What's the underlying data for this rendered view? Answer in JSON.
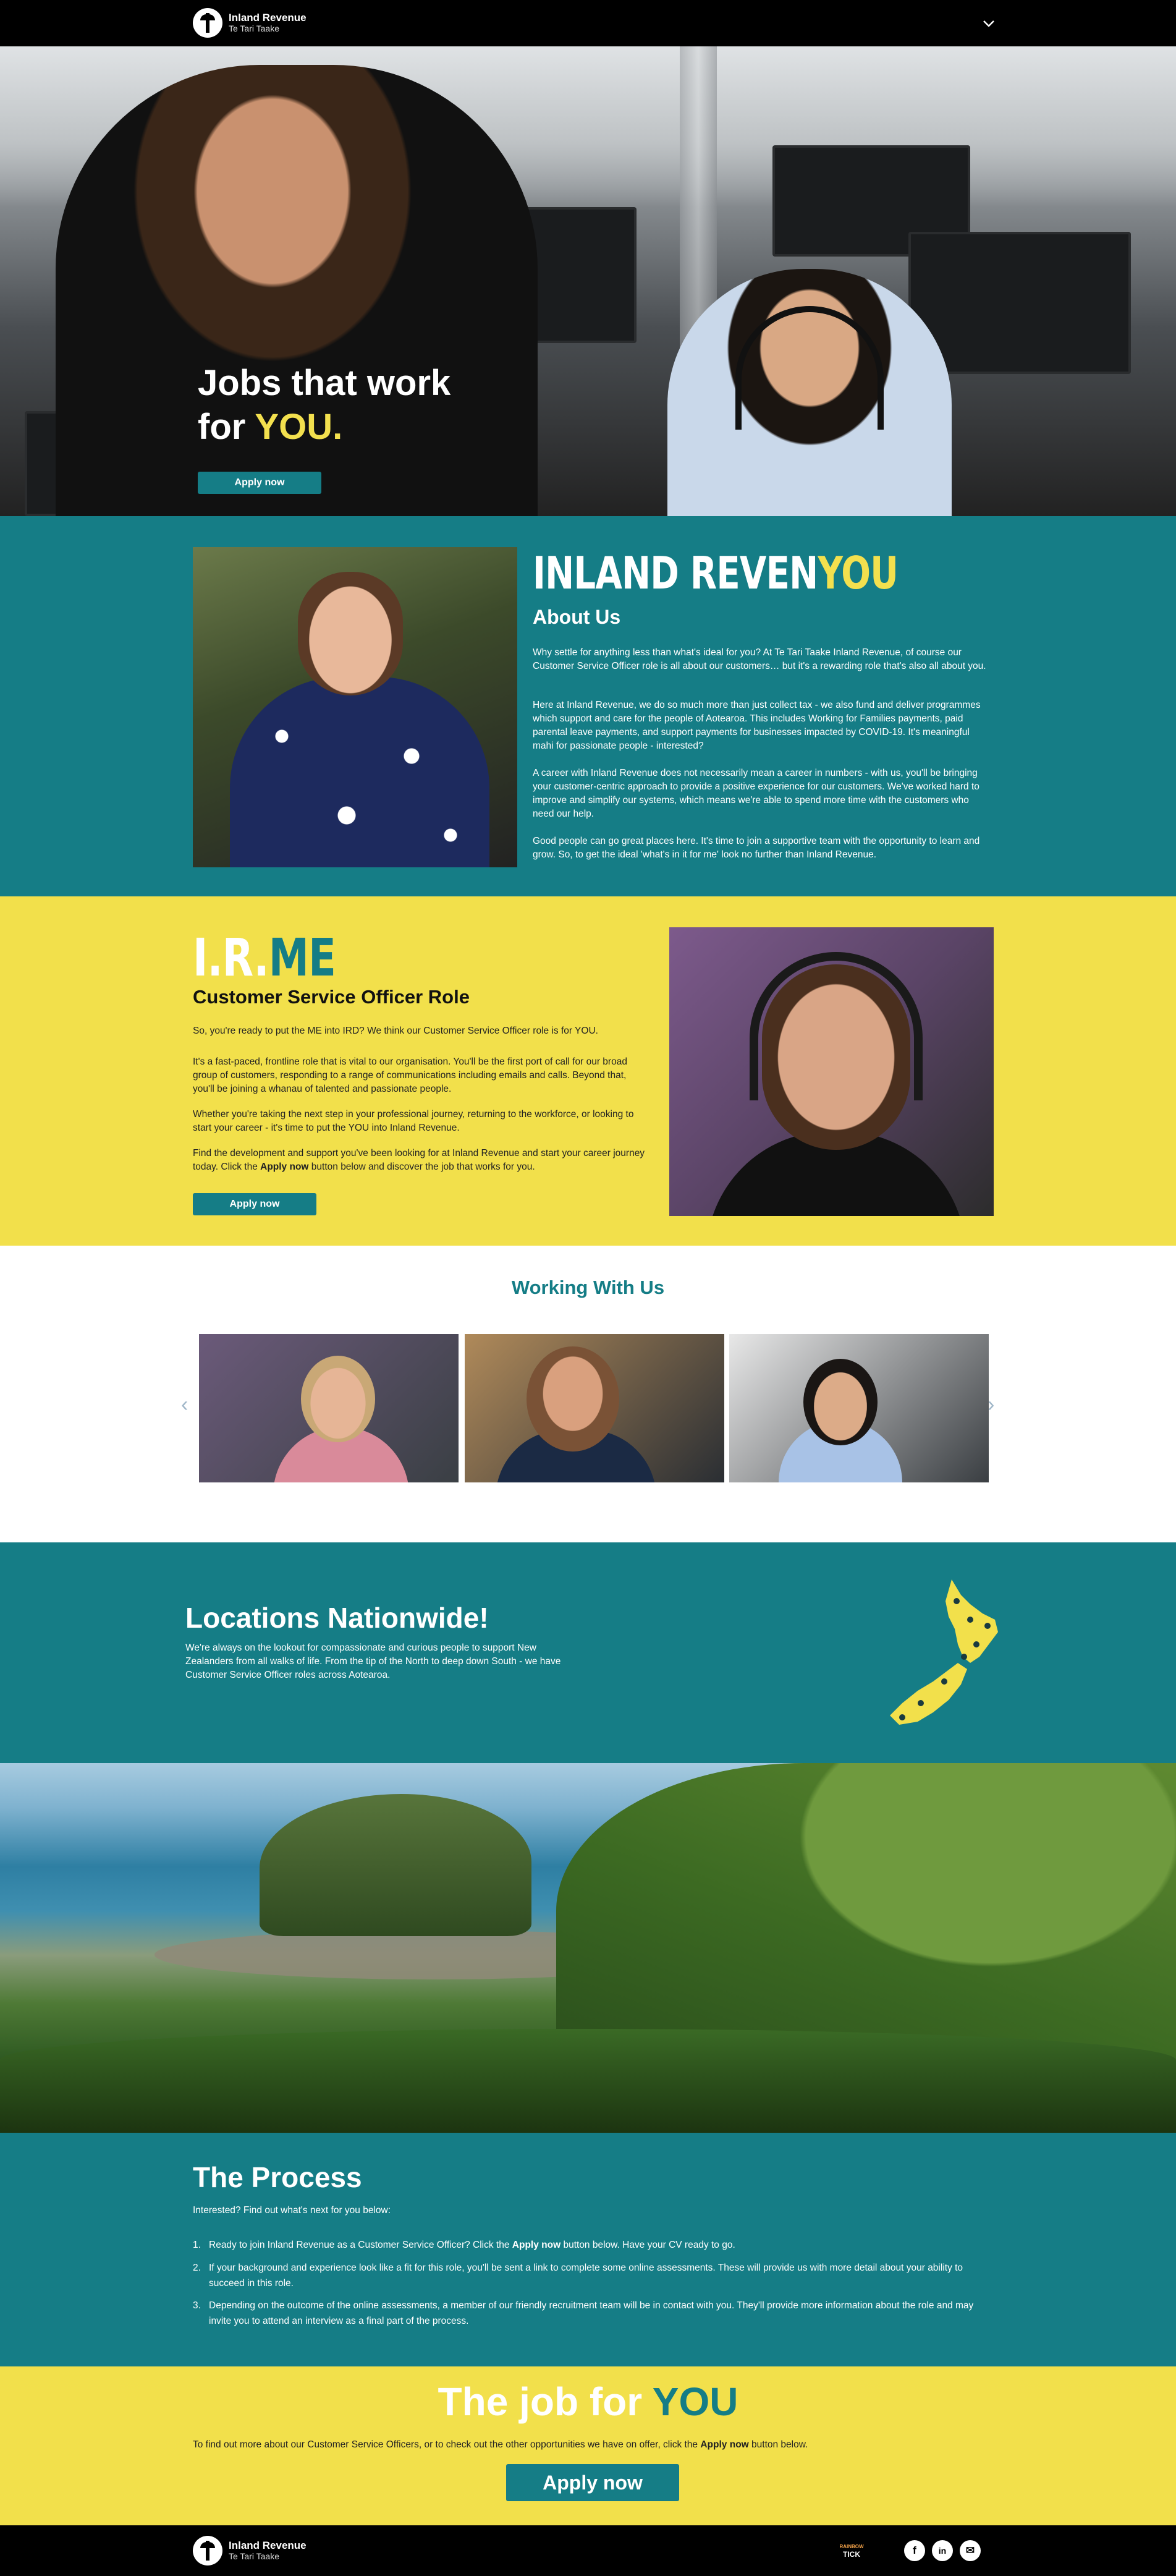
{
  "header": {
    "logo_main": "Inland Revenue",
    "logo_sub": "Te Tari Taake",
    "menu_icon": "chevron-down-icon"
  },
  "hero": {
    "title_line1": "Jobs that work",
    "title_for": "for ",
    "title_you": "YOU.",
    "apply_label": "Apply now"
  },
  "about": {
    "brand_main": "INLAND REVEN",
    "brand_you": "YOU",
    "heading": "About Us",
    "p1": "Why settle for anything less than what's ideal for you? At Te Tari Taake Inland Revenue, of course our Customer Service Officer role is all about our customers… but it's a rewarding role that's also all about you.",
    "p2": "Here at Inland Revenue, we do so much more than just collect tax - we also fund and deliver programmes which support and care for the people of Aotearoa. This includes Working for Families payments, paid parental leave payments, and support payments for businesses impacted by COVID-19. It's meaningful mahi for passionate people - interested?",
    "p3": "A career with Inland Revenue does not necessarily mean a career in numbers - with us, you'll be bringing your customer-centric approach to provide a positive experience for our customers. We've worked hard to improve and simplify our systems, which means we're able to spend more time with the customers who need our help.",
    "p4": "Good people can go great places here. It's time to join a supportive team with the opportunity to learn and grow. So, to get the ideal 'what's in it for me' look no further than Inland Revenue."
  },
  "role": {
    "brand_ir": "I.R.",
    "brand_me": "ME",
    "heading": "Customer Service Officer Role",
    "p1": "So, you're ready to put the ME into IRD? We think our Customer Service Officer role is for YOU.",
    "p2": "It's a fast-paced, frontline role that is vital to our organisation. You'll be the first port of call for our broad group of customers, responding to a range of communications including emails and calls. Beyond that, you'll be joining a whanau of talented and passionate people.",
    "p3": "Whether you're taking the next step in your professional journey, returning to the workforce, or looking to start your career - it's time to put the YOU into Inland Revenue.",
    "p4_pre": "Find the development and support you've been looking for at Inland Revenue and start your career journey today. Click the ",
    "p4_bold": "Apply now",
    "p4_post": " button below and discover the job that works for you.",
    "apply_label": "Apply now"
  },
  "working": {
    "heading": "Working With Us",
    "prev_icon": "chevron-left-icon",
    "next_icon": "chevron-right-icon",
    "prev_glyph": "‹",
    "next_glyph": "›"
  },
  "locations": {
    "heading": "Locations Nationwide!",
    "body": "We're always on the lookout for compassionate and curious people to support New Zealanders from all walks of life. From the tip of the North to deep down South - we have Customer Service Officer roles across Aotearoa."
  },
  "process": {
    "heading": "The Process",
    "intro": "Interested? Find out what's next for you below:",
    "steps": [
      {
        "num": "1.",
        "pre": "Ready to join Inland Revenue as a Customer Service Officer? Click the ",
        "bold": "Apply now",
        "post": " button below. Have your CV ready to go."
      },
      {
        "num": "2.",
        "pre": "If your background and experience look like a fit for this role, you'll be sent a link to complete some online assessments. These will provide us with more detail about your ability to succeed in this role.",
        "bold": "",
        "post": ""
      },
      {
        "num": "3.",
        "pre": "Depending on the outcome of the online assessments, a member of our friendly recruitment team will be in contact with you. They'll provide more information about the role and may invite you to attend an interview as a final part of the process.",
        "bold": "",
        "post": ""
      }
    ]
  },
  "jobfor": {
    "heading_pre": "The job for ",
    "heading_you": "YOU",
    "p_pre": "To find out more about our Customer Service Officers, or to check out the other opportunities we have on offer, click the ",
    "p_bold": "Apply now",
    "p_post": " button below.",
    "apply_label": "Apply now"
  },
  "footer": {
    "logo_main": "Inland Revenue",
    "logo_sub": "Te Tari Taake",
    "badge_line1": "RAINBOW",
    "badge_line2": "TICK",
    "facebook_glyph": "f",
    "linkedin_glyph": "in",
    "email_glyph": "✉"
  },
  "colors": {
    "teal": "#157d86",
    "yellow": "#f2e04b",
    "black": "#000000"
  }
}
